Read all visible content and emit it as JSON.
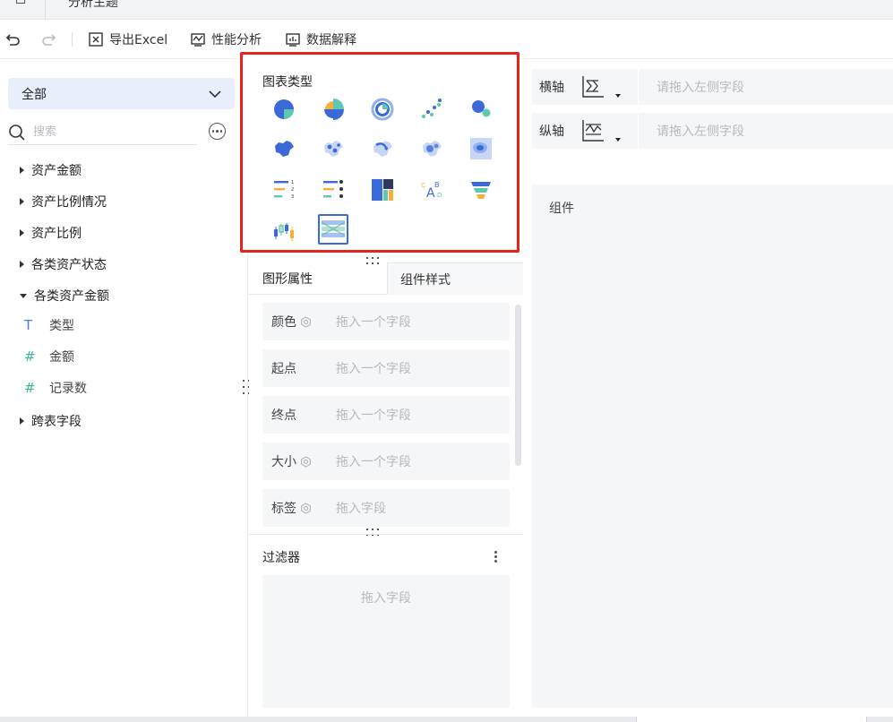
{
  "window": {
    "title": "分析主题"
  },
  "toolbar": {
    "undo_icon": "undo-icon",
    "redo_icon": "redo-icon",
    "export_label": "导出Excel",
    "performance_label": "性能分析",
    "explain_label": "数据解释"
  },
  "sidebar": {
    "selector_value": "全部",
    "search_placeholder": "搜索",
    "tree": [
      {
        "label": "资产金额",
        "expanded": false
      },
      {
        "label": "资产比例情况",
        "expanded": false
      },
      {
        "label": "资产比例",
        "expanded": false
      },
      {
        "label": "各类资产状态",
        "expanded": false
      },
      {
        "label": "各类资产金额",
        "expanded": true
      }
    ],
    "fields": [
      {
        "icon": "T",
        "label": "类型"
      },
      {
        "icon": "#",
        "label": "金额"
      },
      {
        "icon": "#",
        "label": "记录数"
      }
    ],
    "cross_table": "跨表字段"
  },
  "chart_types": {
    "title": "图表类型",
    "icons": [
      "pie-chart-icon",
      "rose-chart-icon",
      "ring-chart-icon",
      "scatter-chart-icon",
      "bubble-chart-icon",
      "area-map-icon",
      "point-map-icon",
      "flow-map-icon",
      "heat-point-map-icon",
      "heatmap-icon",
      "ranked-bar-icon",
      "dot-bar-icon",
      "treemap-icon",
      "word-cloud-icon",
      "funnel-icon",
      "candlestick-icon",
      "sankey-icon"
    ],
    "selected": "sankey-icon"
  },
  "attr_tabs": {
    "graphic": "图形属性",
    "component_style": "组件样式"
  },
  "properties": [
    {
      "label": "颜色",
      "gear": true,
      "placeholder": "拖入一个字段"
    },
    {
      "label": "起点",
      "gear": false,
      "placeholder": "拖入一个字段"
    },
    {
      "label": "终点",
      "gear": false,
      "placeholder": "拖入一个字段"
    },
    {
      "label": "大小",
      "gear": true,
      "placeholder": "拖入一个字段"
    },
    {
      "label": "标签",
      "gear": true,
      "placeholder": "拖入字段"
    }
  ],
  "filter": {
    "title": "过滤器",
    "placeholder": "拖入字段"
  },
  "axes": {
    "x_label": "横轴",
    "x_placeholder": "请拖入左侧字段",
    "y_label": "纵轴",
    "y_placeholder": "请拖入左侧字段"
  },
  "canvas": {
    "label": "组件"
  },
  "colors": {
    "accent": "#3a6ad8",
    "highlight_border": "#e8231f",
    "selector_bg": "#e8eefc"
  }
}
